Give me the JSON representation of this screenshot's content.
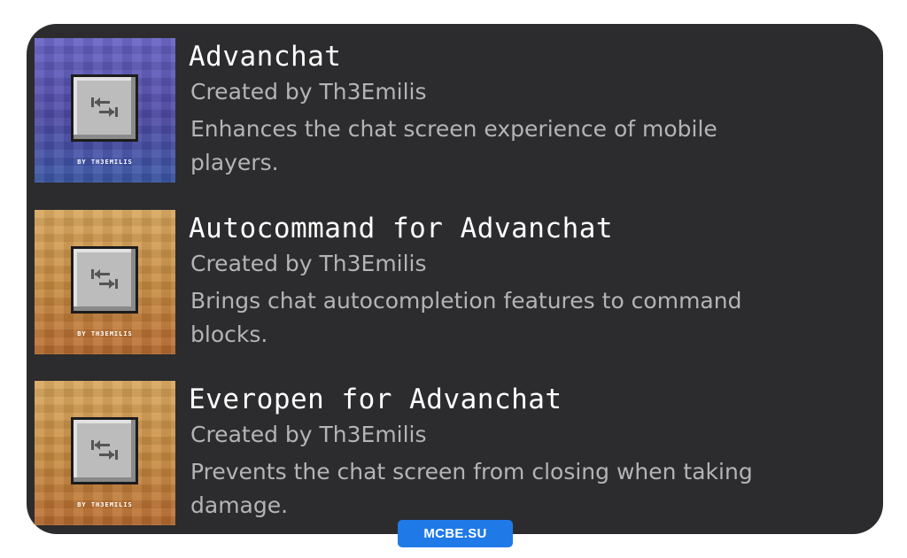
{
  "packs": [
    {
      "title": "Advanchat",
      "author": "Created by Th3Emilis",
      "description": "Enhances the chat screen experience of mobile players.",
      "thumbnail": {
        "icon": "tab-key-icon",
        "byline": "BY TH3EMILIS",
        "color": "#5654b0"
      }
    },
    {
      "title": "Autocommand for Advanchat",
      "author": "Created by Th3Emilis",
      "description": "Brings chat autocompletion features to command blocks.",
      "thumbnail": {
        "icon": "tab-key-icon",
        "byline": "BY TH3EMILIS",
        "color": "#c6893c"
      }
    },
    {
      "title": "Everopen for Advanchat",
      "author": "Created by Th3Emilis",
      "description": "Prevents the chat screen from closing when taking damage.",
      "thumbnail": {
        "icon": "tab-key-icon",
        "byline": "BY TH3EMILIS",
        "color": "#c6893c"
      }
    }
  ],
  "watermark": "MCBE.SU",
  "colors": {
    "panel_background": "#2c2c2e",
    "title_text": "#ffffff",
    "secondary_text": "#b4b4b6",
    "watermark_background": "#1f7ae8"
  }
}
